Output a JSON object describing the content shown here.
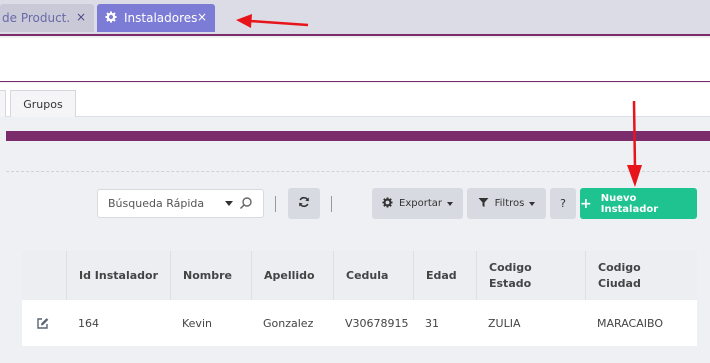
{
  "tabs": [
    {
      "label": "de Product...",
      "close": "×"
    },
    {
      "label": "Instaladores",
      "close": "×"
    }
  ],
  "subtabs": [
    {
      "label": ""
    },
    {
      "label": "Grupos"
    }
  ],
  "toolbar": {
    "search_placeholder": "Búsqueda Rápida",
    "exportar_label": "Exportar",
    "filtros_label": "Filtros",
    "help_label": "?",
    "nuevo_label": "Nuevo Instalador"
  },
  "table": {
    "headers": [
      "Id Instalador",
      "Nombre",
      "Apellido",
      "Cedula",
      "Edad",
      "Codigo Estado",
      "Codigo Ciudad"
    ],
    "rows": [
      [
        "164",
        "Kevin",
        "Gonzalez",
        "V30678915",
        "31",
        "ZULIA",
        "MARACAIBO"
      ]
    ]
  },
  "colors": {
    "accent": "#7a2d6a",
    "tab_active": "#7c7cd6",
    "primary_button": "#1ec38f",
    "annotation_arrow": "#e8141c"
  },
  "icons": [
    "gear-icon",
    "close-icon",
    "caret-down-icon",
    "search-icon",
    "refresh-icon",
    "filter-icon",
    "plus-icon",
    "edit-icon",
    "arrow-annotation"
  ]
}
